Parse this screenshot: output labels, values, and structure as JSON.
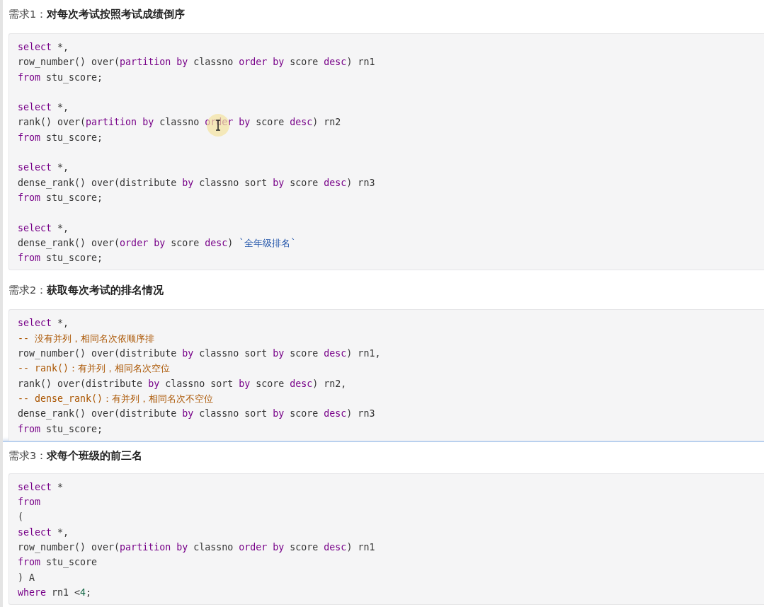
{
  "sections": [
    {
      "heading": "需求1：**对每次考试按照考试成绩倒序**",
      "cut_off": false,
      "cursor": true,
      "lines": [
        {
          "kind": "code",
          "tokens": [
            {
              "kind": "kw",
              "text": "select"
            },
            {
              "kind": "p",
              "text": " *,"
            }
          ]
        },
        {
          "kind": "code",
          "tokens": [
            {
              "kind": "p",
              "text": "row_number() over("
            },
            {
              "kind": "kw",
              "text": "partition by"
            },
            {
              "kind": "p",
              "text": " classno "
            },
            {
              "kind": "kw",
              "text": "order by"
            },
            {
              "kind": "p",
              "text": " score "
            },
            {
              "kind": "kw",
              "text": "desc"
            },
            {
              "kind": "p",
              "text": ") rn1"
            }
          ]
        },
        {
          "kind": "code",
          "tokens": [
            {
              "kind": "kw",
              "text": "from"
            },
            {
              "kind": "p",
              "text": " stu_score;"
            }
          ]
        },
        {
          "kind": "blank"
        },
        {
          "kind": "code",
          "tokens": [
            {
              "kind": "kw",
              "text": "select"
            },
            {
              "kind": "p",
              "text": " *,"
            }
          ]
        },
        {
          "kind": "code",
          "tokens": [
            {
              "kind": "p",
              "text": "rank() over("
            },
            {
              "kind": "kw",
              "text": "partition by"
            },
            {
              "kind": "p",
              "text": " classno "
            },
            {
              "kind": "kw",
              "text": "order by"
            },
            {
              "kind": "p",
              "text": " score "
            },
            {
              "kind": "kw",
              "text": "desc"
            },
            {
              "kind": "p",
              "text": ") rn2"
            }
          ]
        },
        {
          "kind": "code",
          "tokens": [
            {
              "kind": "kw",
              "text": "from"
            },
            {
              "kind": "p",
              "text": " stu_score;"
            }
          ]
        },
        {
          "kind": "blank"
        },
        {
          "kind": "code",
          "tokens": [
            {
              "kind": "kw",
              "text": "select"
            },
            {
              "kind": "p",
              "text": " *,"
            }
          ]
        },
        {
          "kind": "code",
          "tokens": [
            {
              "kind": "p",
              "text": "dense_rank() over(distribute "
            },
            {
              "kind": "kw",
              "text": "by"
            },
            {
              "kind": "p",
              "text": " classno sort "
            },
            {
              "kind": "kw",
              "text": "by"
            },
            {
              "kind": "p",
              "text": " score "
            },
            {
              "kind": "kw",
              "text": "desc"
            },
            {
              "kind": "p",
              "text": ") rn3"
            }
          ]
        },
        {
          "kind": "code",
          "tokens": [
            {
              "kind": "kw",
              "text": "from"
            },
            {
              "kind": "p",
              "text": " stu_score;"
            }
          ]
        },
        {
          "kind": "blank"
        },
        {
          "kind": "code",
          "tokens": [
            {
              "kind": "kw",
              "text": "select"
            },
            {
              "kind": "p",
              "text": " *,"
            }
          ]
        },
        {
          "kind": "code",
          "tokens": [
            {
              "kind": "p",
              "text": "dense_rank() over("
            },
            {
              "kind": "kw",
              "text": "order by"
            },
            {
              "kind": "p",
              "text": " score "
            },
            {
              "kind": "kw",
              "text": "desc"
            },
            {
              "kind": "p",
              "text": ") "
            },
            {
              "kind": "str",
              "text": "`全年级排名`"
            }
          ]
        },
        {
          "kind": "code",
          "tokens": [
            {
              "kind": "kw",
              "text": "from"
            },
            {
              "kind": "p",
              "text": " stu_score;"
            }
          ]
        }
      ]
    },
    {
      "heading": "需求2：**获取每次考试的排名情况**",
      "cut_off": true,
      "lines": [
        {
          "kind": "code",
          "tokens": [
            {
              "kind": "kw",
              "text": "select"
            },
            {
              "kind": "p",
              "text": " *,"
            }
          ]
        },
        {
          "kind": "code",
          "tokens": [
            {
              "kind": "cm",
              "text": "-- 没有并列，相同名次依顺序排"
            }
          ]
        },
        {
          "kind": "code",
          "tokens": [
            {
              "kind": "p",
              "text": "row_number() over(distribute "
            },
            {
              "kind": "kw",
              "text": "by"
            },
            {
              "kind": "p",
              "text": " classno sort "
            },
            {
              "kind": "kw",
              "text": "by"
            },
            {
              "kind": "p",
              "text": " score "
            },
            {
              "kind": "kw",
              "text": "desc"
            },
            {
              "kind": "p",
              "text": ") rn1,"
            }
          ]
        },
        {
          "kind": "code",
          "tokens": [
            {
              "kind": "cm",
              "text": "-- rank()：有并列，相同名次空位"
            }
          ]
        },
        {
          "kind": "code",
          "tokens": [
            {
              "kind": "p",
              "text": "rank() over(distribute "
            },
            {
              "kind": "kw",
              "text": "by"
            },
            {
              "kind": "p",
              "text": " classno sort "
            },
            {
              "kind": "kw",
              "text": "by"
            },
            {
              "kind": "p",
              "text": " score "
            },
            {
              "kind": "kw",
              "text": "desc"
            },
            {
              "kind": "p",
              "text": ") rn2,"
            }
          ]
        },
        {
          "kind": "code",
          "tokens": [
            {
              "kind": "cm",
              "text": "-- dense_rank()：有并列，相同名次不空位"
            }
          ]
        },
        {
          "kind": "code",
          "tokens": [
            {
              "kind": "p",
              "text": "dense_rank() over(distribute "
            },
            {
              "kind": "kw",
              "text": "by"
            },
            {
              "kind": "p",
              "text": " classno sort "
            },
            {
              "kind": "kw",
              "text": "by"
            },
            {
              "kind": "p",
              "text": " score "
            },
            {
              "kind": "kw",
              "text": "desc"
            },
            {
              "kind": "p",
              "text": ") rn3"
            }
          ]
        },
        {
          "kind": "code",
          "tokens": [
            {
              "kind": "kw",
              "text": "from"
            },
            {
              "kind": "p",
              "text": " stu_score;"
            }
          ]
        }
      ]
    },
    {
      "heading": "需求3：**求每个班级的前三名**",
      "floating": true,
      "cut_off": false,
      "lines": [
        {
          "kind": "code",
          "tokens": [
            {
              "kind": "kw",
              "text": "select"
            },
            {
              "kind": "p",
              "text": " *"
            }
          ]
        },
        {
          "kind": "code",
          "tokens": [
            {
              "kind": "kw",
              "text": "from"
            }
          ]
        },
        {
          "kind": "code",
          "tokens": [
            {
              "kind": "p",
              "text": "("
            }
          ]
        },
        {
          "kind": "code",
          "tokens": [
            {
              "kind": "kw",
              "text": "select"
            },
            {
              "kind": "p",
              "text": " *,"
            }
          ]
        },
        {
          "kind": "code",
          "tokens": [
            {
              "kind": "p",
              "text": "row_number() over("
            },
            {
              "kind": "kw",
              "text": "partition by"
            },
            {
              "kind": "p",
              "text": " classno "
            },
            {
              "kind": "kw",
              "text": "order by"
            },
            {
              "kind": "p",
              "text": " score "
            },
            {
              "kind": "kw",
              "text": "desc"
            },
            {
              "kind": "p",
              "text": ") rn1"
            }
          ]
        },
        {
          "kind": "code",
          "tokens": [
            {
              "kind": "kw",
              "text": "from"
            },
            {
              "kind": "p",
              "text": " stu_score"
            }
          ]
        },
        {
          "kind": "code",
          "tokens": [
            {
              "kind": "p",
              "text": ") A"
            }
          ]
        },
        {
          "kind": "code",
          "tokens": [
            {
              "kind": "kw",
              "text": "where"
            },
            {
              "kind": "p",
              "text": " rn1 <"
            },
            {
              "kind": "num",
              "text": "4"
            },
            {
              "kind": "p",
              "text": ";"
            }
          ]
        }
      ]
    }
  ]
}
